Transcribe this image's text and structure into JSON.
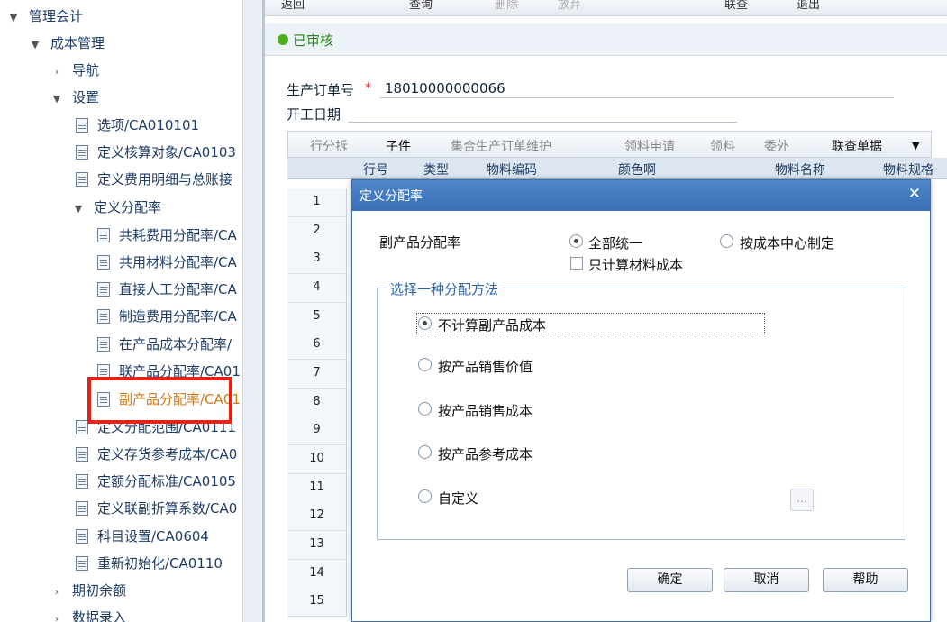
{
  "sidebar": {
    "items": [
      {
        "label": "管理会计",
        "chev": "▼"
      },
      {
        "label": "成本管理",
        "chev": "▼"
      },
      {
        "label": "导航",
        "chev": "›"
      },
      {
        "label": "设置",
        "chev": "▼"
      },
      {
        "label": "选项/CA010101"
      },
      {
        "label": "定义核算对象/CA0103"
      },
      {
        "label": "定义费用明细与总账接"
      },
      {
        "label": "定义分配率",
        "chev": "▼"
      },
      {
        "label": "共耗费用分配率/CA"
      },
      {
        "label": "共用材料分配率/CA"
      },
      {
        "label": "直接人工分配率/CA"
      },
      {
        "label": "制造费用分配率/CA"
      },
      {
        "label": "在产品成本分配率/"
      },
      {
        "label": "联产品分配率/CA01"
      },
      {
        "label": "副产品分配率/CA01"
      },
      {
        "label": "定义分配范围/CA0111"
      },
      {
        "label": "定义存货参考成本/CA0"
      },
      {
        "label": "定额分配标准/CA0105"
      },
      {
        "label": "定义联副折算系数/CA0"
      },
      {
        "label": "科目设置/CA0604"
      },
      {
        "label": "重新初始化/CA0110"
      },
      {
        "label": "期初余额",
        "chev": "›"
      },
      {
        "label": "数据录入",
        "chev": "›"
      }
    ]
  },
  "toolbar": {
    "items": [
      "返回",
      "查询",
      "删除",
      "放弃",
      "联查",
      "退出"
    ]
  },
  "status": {
    "text": "已审核",
    "color": "#4caf1f"
  },
  "form": {
    "order_label": "生产订单号",
    "order_value": "18010000000066",
    "start_label": "开工日期"
  },
  "grid_tabs": [
    "行分拆",
    "子件",
    "集合生产订单维护",
    "领料申请",
    "领料",
    "委外",
    "联查单据"
  ],
  "grid_headers": [
    "行号",
    "类型",
    "物料编码",
    "颜色啊",
    "物料名称",
    "物料规格"
  ],
  "rows": [
    "1",
    "2",
    "3",
    "4",
    "5",
    "6",
    "7",
    "8",
    "9",
    "10",
    "11",
    "12",
    "13",
    "14",
    "15"
  ],
  "dialog": {
    "title": "定义分配率",
    "byproduct_label": "副产品分配率",
    "opt_all": "全部统一",
    "opt_center": "按成本中心制定",
    "chk_material_only": "只计算材料成本",
    "group_legend": "选择一种分配方法",
    "methods": [
      "不计算副产品成本",
      "按产品销售价值",
      "按产品销售成本",
      "按产品参考成本",
      "自定义"
    ],
    "dots": "...",
    "ok": "确定",
    "cancel": "取消",
    "help": "帮助"
  }
}
